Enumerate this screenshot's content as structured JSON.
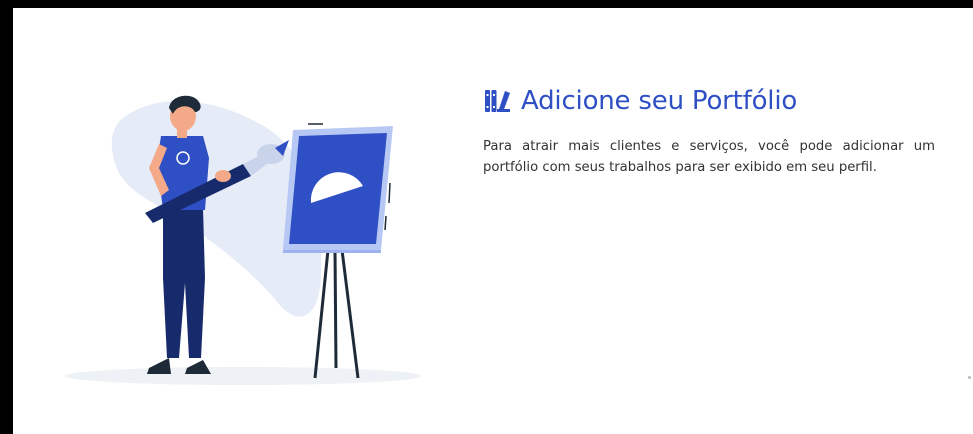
{
  "portfolio": {
    "icon": "portfolio-books-icon",
    "title": "Adicione seu Portfólio",
    "description": "Para atrair mais clientes e serviços, você pode adicionar um portfólio com seus trabalhos para ser exibido em seu perfil."
  },
  "colors": {
    "accent": "#2f4fc4",
    "navy": "#172a6b",
    "blob": "#e6ebf8",
    "text": "#333333"
  }
}
